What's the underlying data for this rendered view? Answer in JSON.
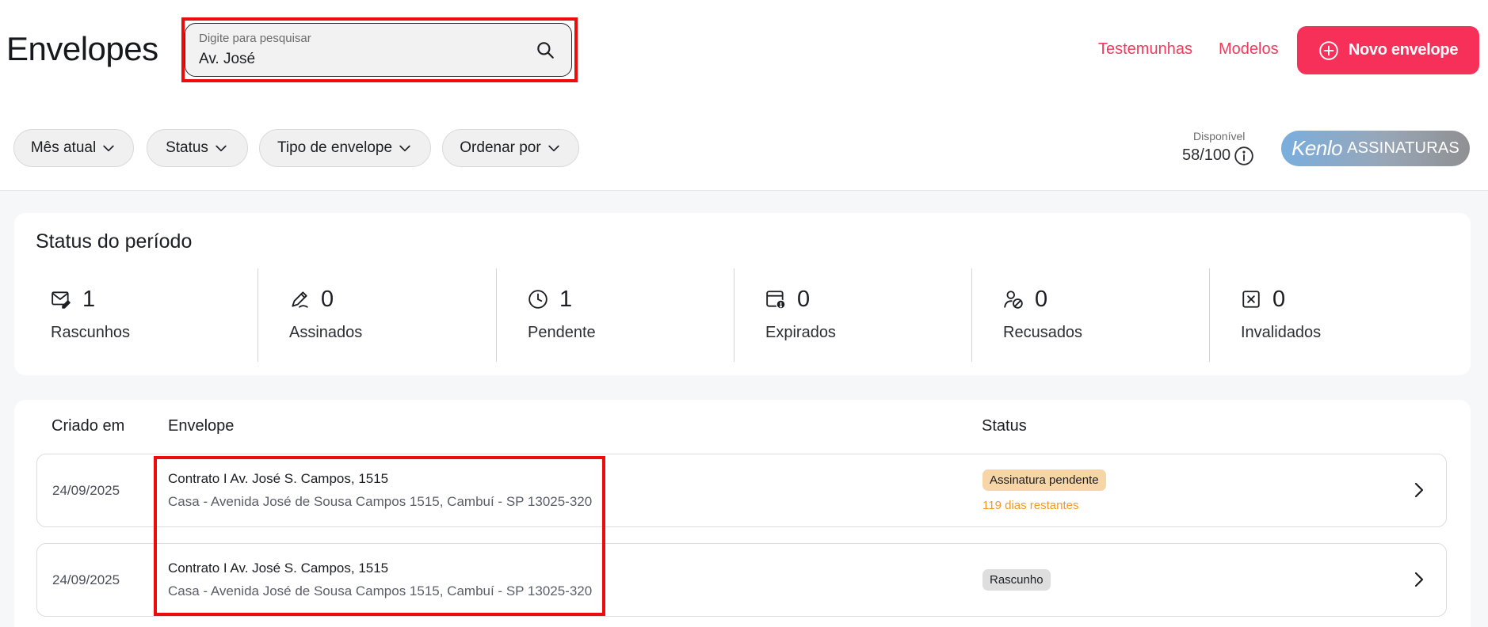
{
  "header": {
    "title": "Envelopes",
    "search": {
      "placeholder": "Digite para pesquisar",
      "value": "Av. José"
    },
    "links": {
      "witnesses": "Testemunhas",
      "templates": "Modelos"
    },
    "new_button": "Novo envelope",
    "accent_color": "#f7305a"
  },
  "filters": [
    "Mês atual",
    "Status",
    "Tipo de envelope",
    "Ordenar por"
  ],
  "availability": {
    "label": "Disponível",
    "value": "58/100"
  },
  "brand": {
    "script": "Kenlo",
    "word": "ASSINATURAS"
  },
  "status_period": {
    "title": "Status do período",
    "items": [
      {
        "icon": "envelope-edit-icon",
        "count": "1",
        "label": "Rascunhos"
      },
      {
        "icon": "pen-icon",
        "count": "0",
        "label": "Assinados"
      },
      {
        "icon": "clock-icon",
        "count": "1",
        "label": "Pendente"
      },
      {
        "icon": "calendar-alert-icon",
        "count": "0",
        "label": "Expirados"
      },
      {
        "icon": "user-block-icon",
        "count": "0",
        "label": "Recusados"
      },
      {
        "icon": "x-square-icon",
        "count": "0",
        "label": "Invalidados"
      }
    ]
  },
  "table": {
    "headers": {
      "created": "Criado em",
      "envelope": "Envelope",
      "status": "Status"
    },
    "rows": [
      {
        "date": "24/09/2025",
        "title": "Contrato I Av. José S. Campos, 1515",
        "subtitle": "Casa - Avenida José de Sousa Campos 1515, Cambuí - SP 13025-320",
        "status": "Assinatura pendente",
        "days_left": "119 dias restantes"
      },
      {
        "date": "24/09/2025",
        "title": "Contrato I Av. José S. Campos, 1515",
        "subtitle": "Casa - Avenida José de Sousa Campos 1515, Cambuí - SP 13025-320",
        "status": "Rascunho"
      }
    ]
  }
}
